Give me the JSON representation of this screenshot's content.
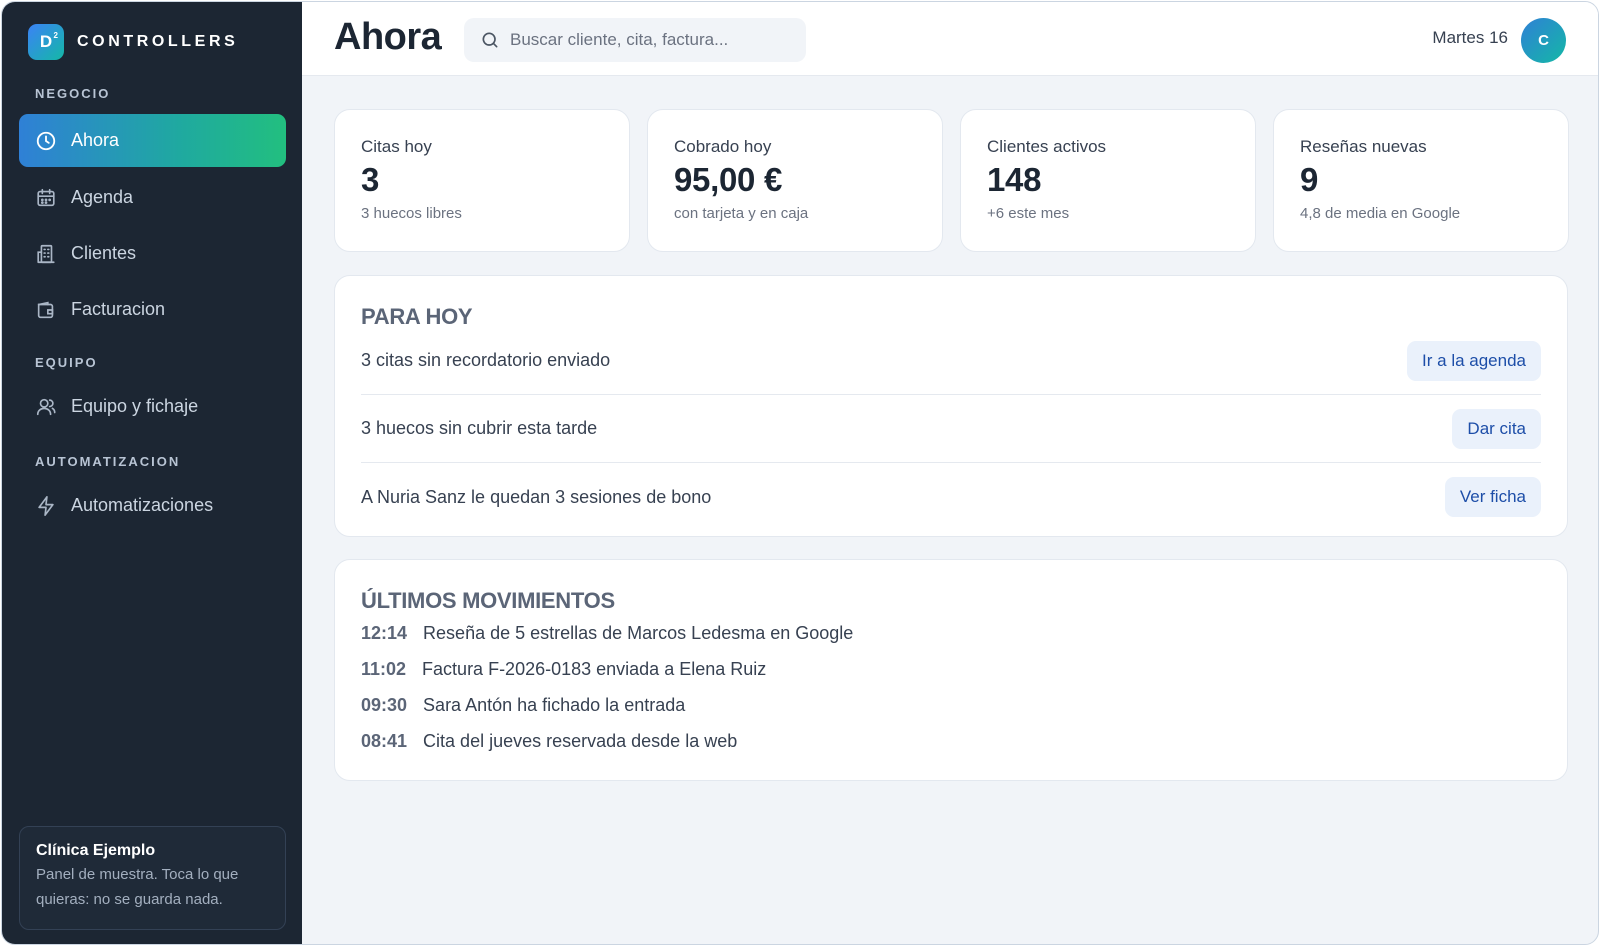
{
  "brand": {
    "logo_text": "D",
    "logo_sup": "2",
    "name": "CONTROLLERS"
  },
  "sidebar": {
    "sections": [
      {
        "label": "NEGOCIO"
      },
      {
        "label": "EQUIPO"
      },
      {
        "label": "AUTOMATIZACION"
      }
    ],
    "items": [
      {
        "label": "Ahora",
        "icon": "clock-icon",
        "active": true
      },
      {
        "label": "Agenda",
        "icon": "calendar-icon"
      },
      {
        "label": "Clientes",
        "icon": "building-icon"
      },
      {
        "label": "Facturacion",
        "icon": "wallet-icon"
      },
      {
        "label": "Equipo y fichaje",
        "icon": "user-icon"
      },
      {
        "label": "Automatizaciones",
        "icon": "lightning-icon"
      }
    ],
    "clinic": {
      "name": "Clínica Ejemplo",
      "description": "Panel de muestra. Toca lo que quieras: no se guarda nada."
    }
  },
  "header": {
    "title": "Ahora",
    "search_placeholder": "Buscar cliente, cita, factura...",
    "date": "Martes 16",
    "avatar_initial": "C"
  },
  "stats": [
    {
      "label": "Citas hoy",
      "value": "3",
      "sub": "3 huecos libres"
    },
    {
      "label": "Cobrado hoy",
      "value": "95,00 €",
      "sub": "con tarjeta y en caja"
    },
    {
      "label": "Clientes activos",
      "value": "148",
      "sub": "+6 este mes"
    },
    {
      "label": "Reseñas nuevas",
      "value": "9",
      "sub": "4,8 de media en Google"
    }
  ],
  "today": {
    "title": "PARA HOY",
    "tasks": [
      {
        "text": "3 citas sin recordatorio enviado",
        "action": "Ir a la agenda"
      },
      {
        "text": "3 huecos sin cubrir esta tarde",
        "action": "Dar cita"
      },
      {
        "text": "A Nuria Sanz le quedan 3 sesiones de bono",
        "action": "Ver ficha"
      }
    ]
  },
  "movements": {
    "title": "ÚLTIMOS MOVIMIENTOS",
    "items": [
      {
        "time": "12:14",
        "text": "Reseña de 5 estrellas de Marcos Ledesma en Google"
      },
      {
        "time": "11:02",
        "text": "Factura F-2026-0183 enviada a Elena Ruiz"
      },
      {
        "time": "09:30",
        "text": "Sara Antón ha fichado la entrada"
      },
      {
        "time": "08:41",
        "text": "Cita del jueves reservada desde la web"
      }
    ]
  },
  "colors": {
    "sidebar_bg": "#1c2633",
    "accent_start": "#2f80d6",
    "accent_end": "#22bf7f",
    "button_bg": "#eaf1fb",
    "button_text": "#1d4ea8"
  }
}
